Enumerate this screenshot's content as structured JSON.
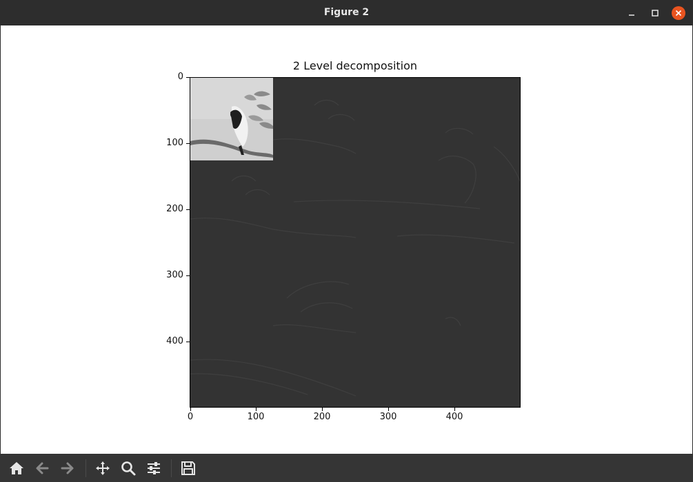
{
  "window": {
    "title": "Figure 2"
  },
  "plot": {
    "title": "2 Level decomposition",
    "y_ticks": [
      "0",
      "100",
      "200",
      "300",
      "400"
    ],
    "x_ticks": [
      "0",
      "100",
      "200",
      "300",
      "400"
    ],
    "image_extent": [
      0,
      500
    ]
  },
  "toolbar": {
    "buttons": [
      "home-icon",
      "back-arrow-icon",
      "forward-arrow-icon",
      "pan-icon",
      "zoom-icon",
      "configure-subplots-icon",
      "save-icon"
    ]
  },
  "colors": {
    "titlebar": "#2d2d2d",
    "close_button": "#e95420",
    "toolbar": "#353535",
    "figure_bg": "#ffffff",
    "detail_bg": "#333333"
  }
}
